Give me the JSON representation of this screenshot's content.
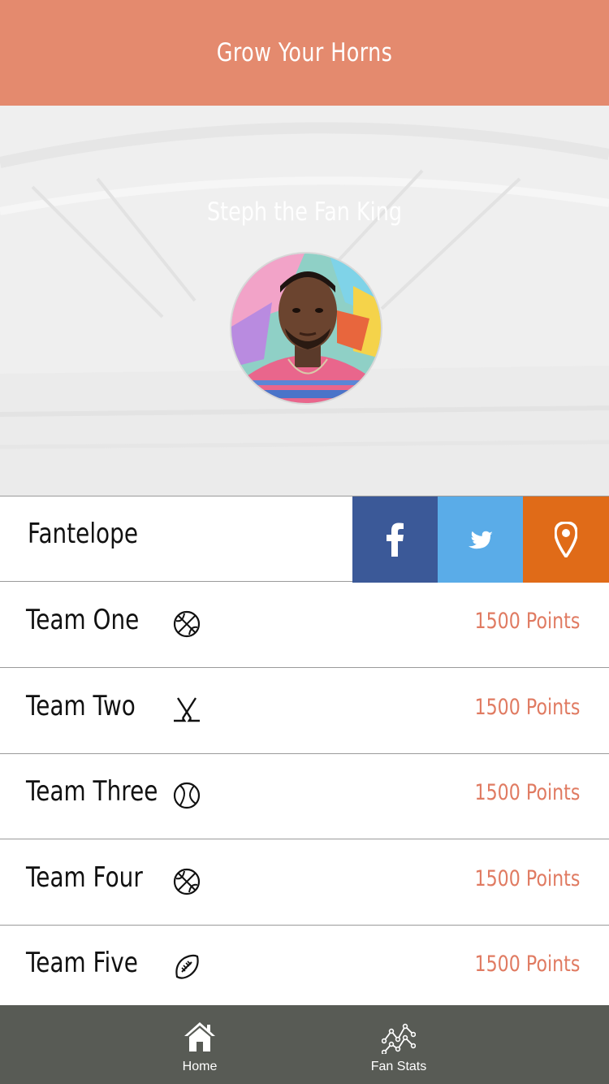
{
  "header": {
    "title": "Grow Your Horns"
  },
  "profile": {
    "name": "Steph the Fan King"
  },
  "brand": {
    "name": "Fantelope"
  },
  "social": [
    "facebook-icon",
    "twitter-icon",
    "location-pin-icon"
  ],
  "teams": [
    {
      "name": "Team One",
      "sport_icon": "basketball-icon",
      "points": "1500 Points"
    },
    {
      "name": "Team Two",
      "sport_icon": "hockey-sticks-icon",
      "points": "1500 Points"
    },
    {
      "name": "Team Three",
      "sport_icon": "baseball-icon",
      "points": "1500 Points"
    },
    {
      "name": "Team Four",
      "sport_icon": "basketball-icon",
      "points": "1500 Points"
    },
    {
      "name": "Team Five",
      "sport_icon": "football-icon",
      "points": "1500 Points"
    }
  ],
  "tabbar": {
    "home_label": "Home",
    "stats_label": "Fan Stats"
  },
  "colors": {
    "header": "#e48a6e",
    "points": "#e07b62",
    "facebook": "#3b5998",
    "twitter": "#5aace8",
    "location": "#e06b18",
    "tabbar": "#585b55"
  }
}
